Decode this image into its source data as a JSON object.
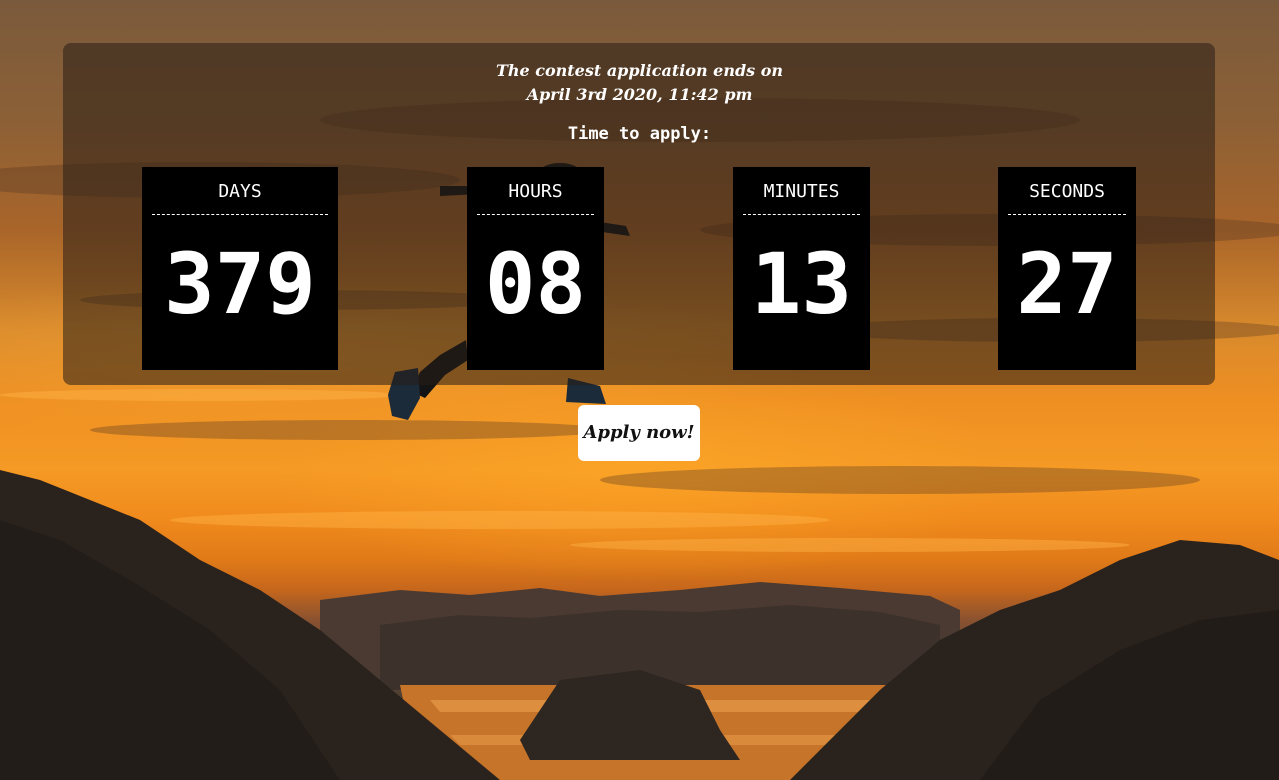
{
  "headline": {
    "line1": "The contest application ends on",
    "line2": "April 3rd 2020, 11:42 pm"
  },
  "subhead": "Time to apply:",
  "countdown": [
    {
      "unit": "DAYS",
      "value": "379"
    },
    {
      "unit": "HOURS",
      "value": "08"
    },
    {
      "unit": "MINUTES",
      "value": "13"
    },
    {
      "unit": "SECONDS",
      "value": "27"
    }
  ],
  "apply_button": "Apply now!",
  "colors": {
    "card_background": "#000000",
    "text": "#ffffff",
    "button_background": "#ffffff",
    "button_text": "#111111"
  }
}
